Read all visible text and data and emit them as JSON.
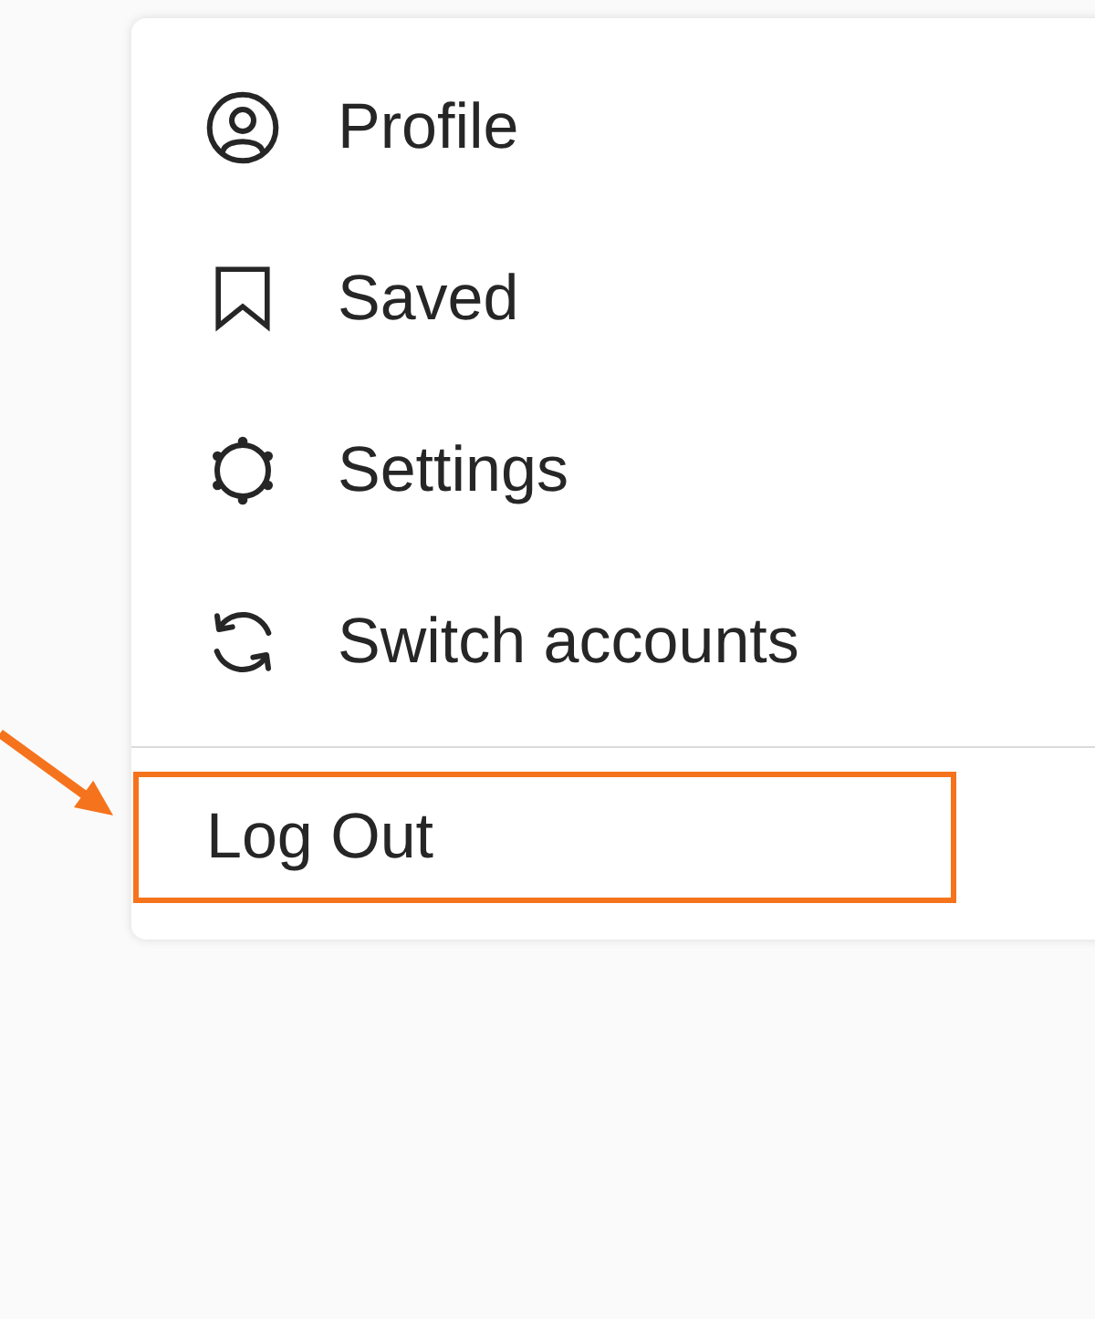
{
  "menu": {
    "items": [
      {
        "label": "Profile",
        "kind": "link",
        "highlighted": false
      },
      {
        "label": "Saved",
        "kind": "link",
        "highlighted": false
      },
      {
        "label": "Settings",
        "kind": "link",
        "highlighted": false
      },
      {
        "label": "Switch accounts",
        "kind": "link",
        "highlighted": false
      },
      {
        "label": "Log Out",
        "kind": "action",
        "highlighted": true
      }
    ]
  }
}
